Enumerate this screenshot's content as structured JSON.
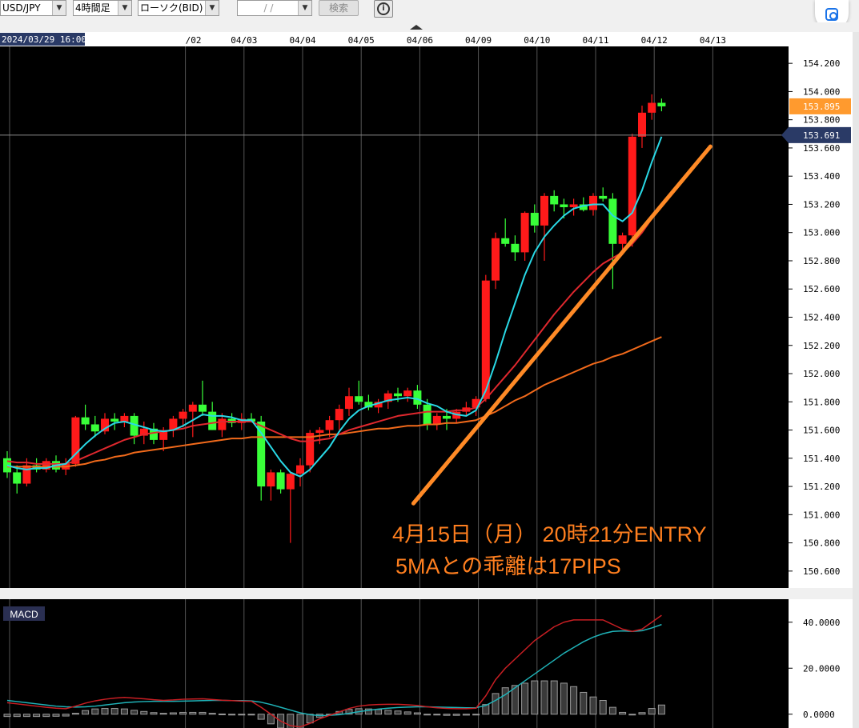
{
  "toolbar": {
    "pair": "USD/JPY",
    "timeframe": "4時間足",
    "chart_type": "ローソク(BID)",
    "date_input": "/ /",
    "search_label": "検索",
    "info_icon": "info-icon",
    "lens_icon": "google-lens-icon"
  },
  "colors": {
    "background": "#000000",
    "up_candle": "#ff1a1a",
    "down_candle": "#39ff39",
    "ma5": "#29d9e6",
    "ma_mid": "#e0282e",
    "ma_long": "#f26a1b",
    "trendline": "#ff8a26",
    "macd_line": "#c81e23",
    "signal_line": "#1fb3b8",
    "histogram": "#9a9a9a"
  },
  "chart_data": [
    {
      "type": "candlestick",
      "date_ticks": [
        "2024/03/29 16:00",
        "/02",
        "04/03",
        "04/04",
        "04/05",
        "04/06",
        "04/09",
        "04/10",
        "04/11",
        "04/12",
        "04/13"
      ],
      "date_tick_candle_index": [
        0,
        18,
        24,
        30,
        36,
        42,
        48,
        54,
        60,
        66,
        72
      ],
      "ylim": [
        150.48,
        154.32
      ],
      "yticks": [
        154.2,
        154.0,
        153.8,
        153.6,
        153.4,
        153.2,
        153.0,
        152.8,
        152.6,
        152.4,
        152.2,
        152.0,
        151.8,
        151.6,
        151.4,
        151.2,
        151.0,
        150.8,
        150.6
      ],
      "ytick_labels": [
        "154.200",
        "154.000",
        "153.800",
        "153.600",
        "153.400",
        "153.200",
        "153.000",
        "152.800",
        "152.600",
        "152.400",
        "152.200",
        "152.000",
        "151.800",
        "151.600",
        "151.400",
        "151.200",
        "151.000",
        "150.800",
        "150.600"
      ],
      "ohlc": [
        [
          151.4,
          151.45,
          151.26,
          151.3
        ],
        [
          151.3,
          151.35,
          151.15,
          151.22
        ],
        [
          151.22,
          151.4,
          151.2,
          151.35
        ],
        [
          151.35,
          151.4,
          151.3,
          151.32
        ],
        [
          151.32,
          151.4,
          151.3,
          151.38
        ],
        [
          151.38,
          151.42,
          151.3,
          151.32
        ],
        [
          151.32,
          151.4,
          151.28,
          151.36
        ],
        [
          151.36,
          151.7,
          151.34,
          151.69
        ],
        [
          151.69,
          151.78,
          151.6,
          151.64
        ],
        [
          151.64,
          151.7,
          151.55,
          151.59
        ],
        [
          151.59,
          151.72,
          151.57,
          151.68
        ],
        [
          151.68,
          151.72,
          151.6,
          151.66
        ],
        [
          151.66,
          151.72,
          151.62,
          151.7
        ],
        [
          151.7,
          151.72,
          151.5,
          151.56
        ],
        [
          151.56,
          151.66,
          151.5,
          151.61
        ],
        [
          151.61,
          151.65,
          151.5,
          151.53
        ],
        [
          151.53,
          151.62,
          151.45,
          151.6
        ],
        [
          151.6,
          151.7,
          151.55,
          151.68
        ],
        [
          151.68,
          151.75,
          151.62,
          151.73
        ],
        [
          151.73,
          151.8,
          151.55,
          151.78
        ],
        [
          151.78,
          151.95,
          151.7,
          151.73
        ],
        [
          151.73,
          151.8,
          151.6,
          151.6
        ],
        [
          151.6,
          151.72,
          151.55,
          151.68
        ],
        [
          151.68,
          151.72,
          151.62,
          151.65
        ],
        [
          151.65,
          151.72,
          151.6,
          151.68
        ],
        [
          151.68,
          151.72,
          151.66,
          151.66
        ],
        [
          151.66,
          151.7,
          151.1,
          151.2
        ],
        [
          151.2,
          151.32,
          151.1,
          151.3
        ],
        [
          151.3,
          151.32,
          151.15,
          151.18
        ],
        [
          151.18,
          151.3,
          150.8,
          151.29
        ],
        [
          151.29,
          151.4,
          151.2,
          151.35
        ],
        [
          151.35,
          151.6,
          151.3,
          151.58
        ],
        [
          151.58,
          151.62,
          151.5,
          151.6
        ],
        [
          151.6,
          151.7,
          151.55,
          151.67
        ],
        [
          151.67,
          151.78,
          151.6,
          151.75
        ],
        [
          151.75,
          151.9,
          151.7,
          151.84
        ],
        [
          151.84,
          151.95,
          151.78,
          151.8
        ],
        [
          151.8,
          151.85,
          151.74,
          151.76
        ],
        [
          151.76,
          151.82,
          151.72,
          151.8
        ],
        [
          151.8,
          151.88,
          151.75,
          151.86
        ],
        [
          151.86,
          151.9,
          151.8,
          151.84
        ],
        [
          151.84,
          151.9,
          151.8,
          151.88
        ],
        [
          151.88,
          151.92,
          151.75,
          151.78
        ],
        [
          151.78,
          151.82,
          151.6,
          151.64
        ],
        [
          151.64,
          151.72,
          151.6,
          151.7
        ],
        [
          151.7,
          151.75,
          151.6,
          151.68
        ],
        [
          151.68,
          151.75,
          151.65,
          151.73
        ],
        [
          151.73,
          151.8,
          151.7,
          151.76
        ],
        [
          151.76,
          151.84,
          151.7,
          151.82
        ],
        [
          151.82,
          152.7,
          151.8,
          152.66
        ],
        [
          152.66,
          153.0,
          152.6,
          152.96
        ],
        [
          152.96,
          153.1,
          152.9,
          152.92
        ],
        [
          152.92,
          152.98,
          152.8,
          152.86
        ],
        [
          152.86,
          153.15,
          152.8,
          153.14
        ],
        [
          153.14,
          153.2,
          153.0,
          153.05
        ],
        [
          153.05,
          153.28,
          152.8,
          153.26
        ],
        [
          153.26,
          153.3,
          153.15,
          153.2
        ],
        [
          153.2,
          153.24,
          153.1,
          153.18
        ],
        [
          153.18,
          153.24,
          153.12,
          153.2
        ],
        [
          153.2,
          153.25,
          153.15,
          153.16
        ],
        [
          153.16,
          153.28,
          153.12,
          153.26
        ],
        [
          153.26,
          153.32,
          153.22,
          153.24
        ],
        [
          153.24,
          153.28,
          152.6,
          152.92
        ],
        [
          152.92,
          153.0,
          152.88,
          152.98
        ],
        [
          152.98,
          153.7,
          152.9,
          153.68
        ],
        [
          153.68,
          153.9,
          153.6,
          153.85
        ],
        [
          153.85,
          153.98,
          153.8,
          153.92
        ],
        [
          153.92,
          153.95,
          153.86,
          153.895
        ]
      ],
      "ma_short": [
        151.35,
        151.33,
        151.32,
        151.33,
        151.33,
        151.35,
        151.36,
        151.43,
        151.5,
        151.56,
        151.61,
        151.65,
        151.66,
        151.64,
        151.62,
        151.6,
        151.59,
        151.6,
        151.63,
        151.67,
        151.71,
        151.7,
        151.7,
        151.69,
        151.67,
        151.67,
        151.58,
        151.48,
        151.38,
        151.3,
        151.27,
        151.32,
        151.4,
        151.48,
        151.59,
        151.68,
        151.74,
        151.77,
        151.79,
        151.81,
        151.82,
        151.83,
        151.82,
        151.79,
        151.77,
        151.73,
        151.71,
        151.7,
        151.74,
        151.88,
        152.08,
        152.3,
        152.5,
        152.7,
        152.86,
        152.97,
        153.05,
        153.12,
        153.17,
        153.19,
        153.2,
        153.2,
        153.12,
        153.08,
        153.14,
        153.3,
        153.5,
        153.68
      ],
      "ma_mid": [
        151.38,
        151.37,
        151.37,
        151.36,
        151.36,
        151.36,
        151.36,
        151.38,
        151.41,
        151.44,
        151.47,
        151.5,
        151.53,
        151.55,
        151.57,
        151.58,
        151.59,
        151.6,
        151.61,
        151.63,
        151.64,
        151.65,
        151.66,
        151.66,
        151.66,
        151.66,
        151.63,
        151.6,
        151.57,
        151.54,
        151.52,
        151.52,
        151.53,
        151.54,
        151.57,
        151.6,
        151.62,
        151.64,
        151.66,
        151.68,
        151.7,
        151.71,
        151.72,
        151.73,
        151.73,
        151.73,
        151.74,
        151.74,
        151.76,
        151.82,
        151.9,
        151.98,
        152.06,
        152.15,
        152.24,
        152.33,
        152.42,
        152.5,
        152.58,
        152.65,
        152.72,
        152.78,
        152.82,
        152.86,
        152.92,
        153.0,
        153.1,
        153.2
      ],
      "ma_long": [
        151.34,
        151.34,
        151.34,
        151.34,
        151.34,
        151.34,
        151.34,
        151.35,
        151.36,
        151.38,
        151.39,
        151.41,
        151.42,
        151.44,
        151.45,
        151.46,
        151.47,
        151.48,
        151.49,
        151.5,
        151.51,
        151.52,
        151.53,
        151.54,
        151.54,
        151.55,
        151.55,
        151.55,
        151.55,
        151.55,
        151.55,
        151.55,
        151.56,
        151.57,
        151.57,
        151.58,
        151.59,
        151.6,
        151.61,
        151.61,
        151.62,
        151.63,
        151.63,
        151.64,
        151.64,
        151.65,
        151.65,
        151.66,
        151.67,
        151.7,
        151.73,
        151.77,
        151.81,
        151.84,
        151.88,
        151.92,
        151.95,
        151.98,
        152.01,
        152.04,
        152.07,
        152.09,
        152.12,
        152.14,
        152.17,
        152.2,
        152.23,
        152.26
      ],
      "trendline": [
        [
          42,
          151.08
        ],
        [
          72,
          153.61
        ]
      ],
      "current_price_label": "153.895",
      "cursor_price_label": "153.691",
      "cursor_price": 153.691,
      "annotation": [
        "4月15日（月） 20時21分ENTRY",
        "5MAとの乖離は17PIPS"
      ]
    },
    {
      "type": "macd",
      "label": "MACD",
      "ylim": [
        -6,
        50
      ],
      "yticks": [
        40,
        20,
        0
      ],
      "ytick_labels": [
        "40.0000",
        "20.0000",
        "0.0000"
      ],
      "macd": [
        5,
        4.5,
        4,
        3.5,
        3,
        2.6,
        2.4,
        3.5,
        4.8,
        5.8,
        6.5,
        7,
        7.3,
        7,
        6.7,
        6.3,
        6,
        6.2,
        6.5,
        6.6,
        6.7,
        6.4,
        6.1,
        5.9,
        5.7,
        5.6,
        3,
        0,
        -3,
        -5,
        -5.5,
        -4,
        -2,
        -0.5,
        1,
        2.5,
        3.5,
        4,
        4.2,
        4.3,
        4.3,
        4.1,
        3.8,
        3.2,
        2.8,
        2.5,
        2.4,
        2.4,
        2.6,
        8,
        15,
        20,
        24,
        28,
        32,
        35,
        38,
        40,
        41,
        41,
        41,
        41,
        39,
        37,
        36,
        37,
        40,
        43
      ],
      "signal": [
        6,
        5.5,
        5,
        4.5,
        4,
        3.5,
        3.2,
        3.1,
        3.2,
        3.5,
        4,
        4.5,
        5,
        5.3,
        5.5,
        5.6,
        5.6,
        5.6,
        5.7,
        5.8,
        5.9,
        6,
        6,
        5.9,
        5.9,
        5.8,
        5.2,
        4.2,
        3,
        1.8,
        0.6,
        -0.2,
        -0.6,
        -0.5,
        -0.2,
        0.4,
        1.1,
        1.7,
        2.2,
        2.6,
        2.9,
        3.1,
        3.2,
        3.2,
        3.1,
        3,
        2.9,
        2.8,
        2.8,
        3.8,
        6,
        8.5,
        11.5,
        14.5,
        17.5,
        20.5,
        23.5,
        26.5,
        29,
        31.5,
        33.5,
        35,
        36,
        36.2,
        36,
        36.3,
        37.5,
        39
      ]
    }
  ]
}
